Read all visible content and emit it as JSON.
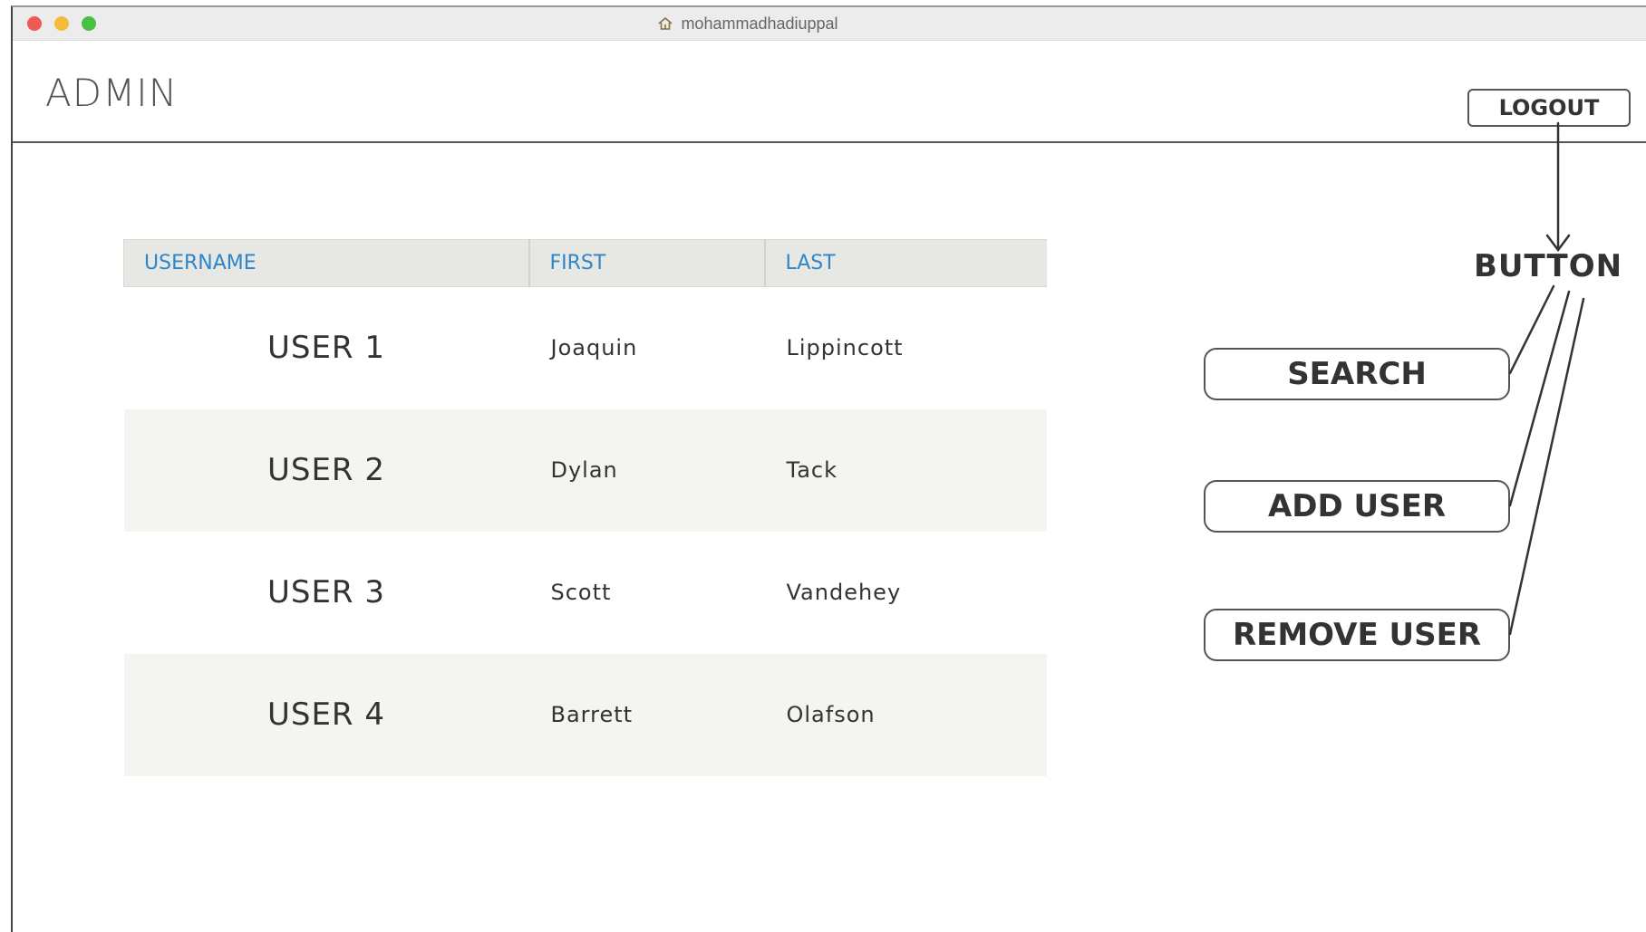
{
  "window": {
    "title": "mohammadhadiuppal"
  },
  "header": {
    "title": "ADMIN",
    "logout_label": "LOGOUT"
  },
  "table": {
    "columns": [
      "USERNAME",
      "FIRST",
      "LAST"
    ],
    "rows": [
      {
        "username": "USER 1",
        "first": "Joaquin",
        "last": "Lippincott"
      },
      {
        "username": "USER 2",
        "first": "Dylan",
        "last": "Tack"
      },
      {
        "username": "USER 3",
        "first": "Scott",
        "last": "Vandehey"
      },
      {
        "username": "USER 4",
        "first": "Barrett",
        "last": "Olafson"
      }
    ]
  },
  "actions": {
    "search_label": "SEARCH",
    "add_user_label": "ADD USER",
    "remove_user_label": "REMOVE USER"
  },
  "annotation": {
    "label": "BUTTON"
  },
  "icons": {
    "window_title_icon": "home-icon"
  },
  "colors": {
    "header_text": "#2e86c9",
    "close": "#ee5b55",
    "minimize": "#f5bb3b",
    "maximize": "#48c143"
  }
}
